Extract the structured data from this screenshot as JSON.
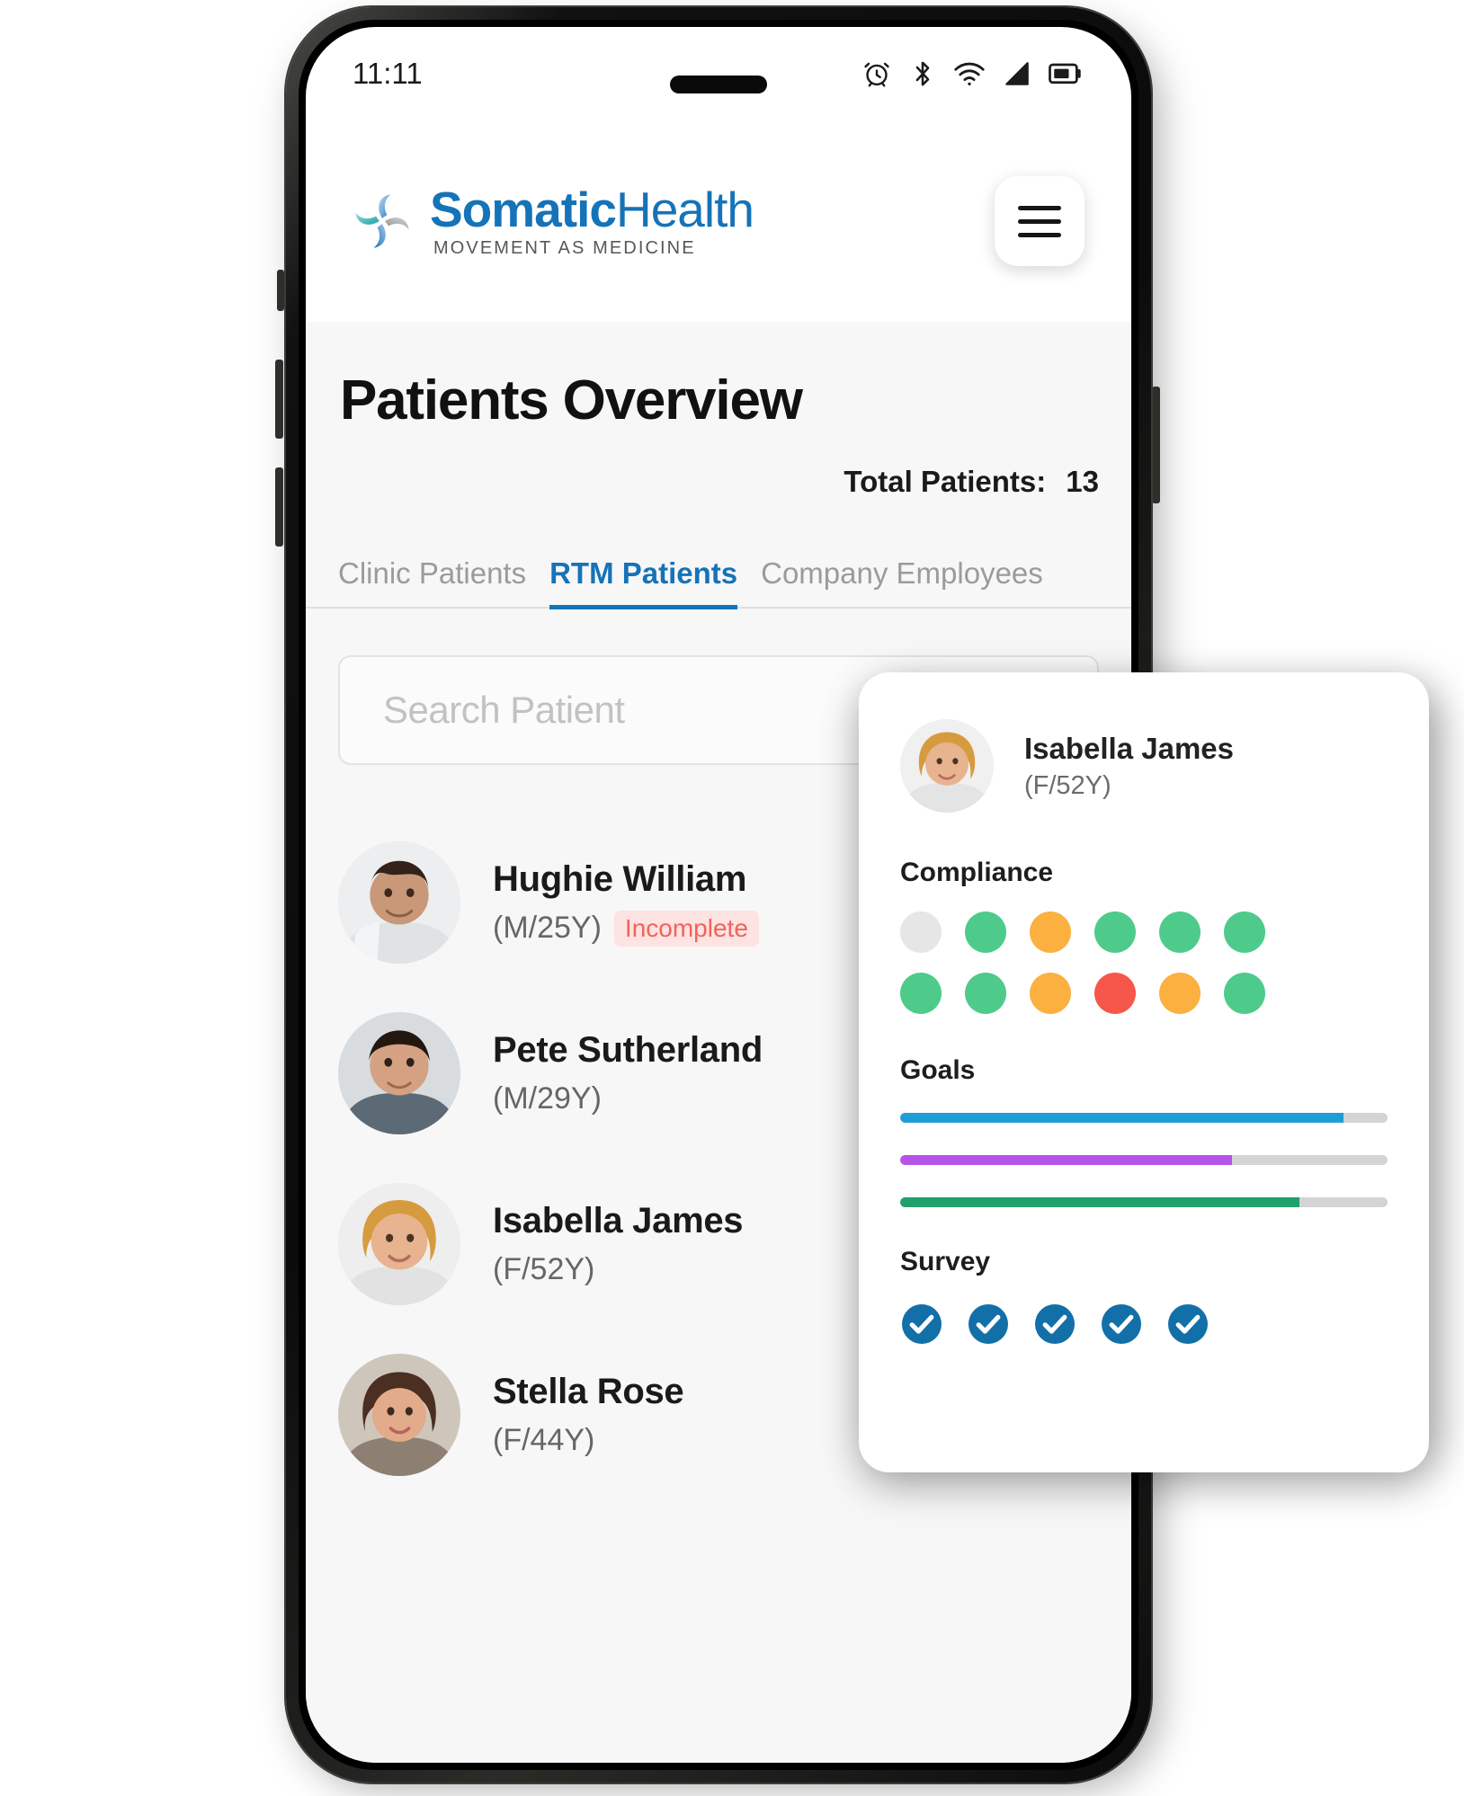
{
  "status_bar": {
    "time": "11:11",
    "icons": [
      "alarm-icon",
      "bluetooth-icon",
      "wifi-icon",
      "cellular-signal-icon",
      "battery-icon"
    ]
  },
  "header": {
    "logo_word_1": "Somatic",
    "logo_word_2": "Health",
    "logo_tagline": "MOVEMENT AS MEDICINE",
    "menu_label": "hamburger-menu"
  },
  "main": {
    "title": "Patients Overview",
    "total_label": "Total Patients:",
    "total_value": "13",
    "tabs": [
      {
        "label": "Clinic Patients",
        "active": false
      },
      {
        "label": "RTM Patients",
        "active": true
      },
      {
        "label": "Company Employees",
        "active": false
      }
    ],
    "search": {
      "placeholder": "Search Patient",
      "value": ""
    },
    "patients": [
      {
        "name": "Hughie William",
        "age": "(M/25Y)",
        "badge": "Incomplete"
      },
      {
        "name": "Pete Sutherland",
        "age": "(M/29Y)",
        "badge": ""
      },
      {
        "name": "Isabella James",
        "age": "(F/52Y)",
        "badge": ""
      },
      {
        "name": "Stella Rose",
        "age": "(F/44Y)",
        "badge": ""
      }
    ]
  },
  "detail_card": {
    "name": "Isabella James",
    "age": "(F/52Y)",
    "compliance": {
      "title": "Compliance",
      "dots": [
        "#e6e6e6",
        "#4ecb8b",
        "#fbb03f",
        "#4ecb8b",
        "#4ecb8b",
        "#4ecb8b",
        "#4ecb8b",
        "#4ecb8b",
        "#fbb03f",
        "#f7564a",
        "#fbb03f",
        "#4ecb8b"
      ]
    },
    "goals": {
      "title": "Goals",
      "bars": [
        {
          "color": "#1d9ed9",
          "percent": 91
        },
        {
          "color": "#b754e8",
          "percent": 68
        },
        {
          "color": "#20a16b",
          "percent": 82
        }
      ]
    },
    "survey": {
      "title": "Survey",
      "checks": 5,
      "color": "#136fa8"
    }
  },
  "colors": {
    "brand_blue": "#1573b8",
    "accent_green": "#4ecb8b",
    "accent_orange": "#fbb03f",
    "accent_red": "#f7564a",
    "badge_red_text": "#f2635c",
    "badge_red_bg": "#fde3e1"
  }
}
